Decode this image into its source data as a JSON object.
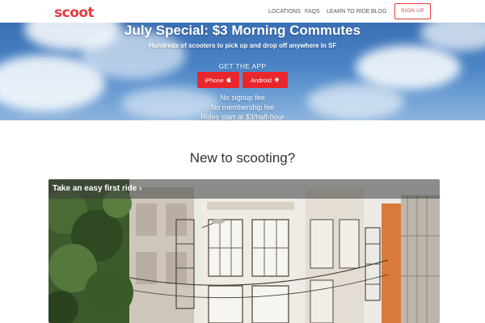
{
  "header": {
    "logo": "scoot",
    "nav": [
      "LOCATIONS",
      "FAQS",
      "LEARN TO RIDE",
      "BLOG"
    ],
    "signup_label": "SIGN UP"
  },
  "hero": {
    "title": "July Special: $3 Morning Commutes",
    "subtitle": "Hundreds of scooters to pick up and drop off anywhere in SF",
    "get_app": "GET THE APP",
    "iphone_label": "iPhone",
    "android_label": "Android",
    "features": [
      "No signup fee",
      "No membership fee",
      "Rides start at $3/half-hour"
    ]
  },
  "section": {
    "title": "New to scooting?"
  },
  "card": {
    "label": "Take an easy first ride"
  },
  "colors": {
    "brand": "#e8383d",
    "button": "#e8262c"
  }
}
